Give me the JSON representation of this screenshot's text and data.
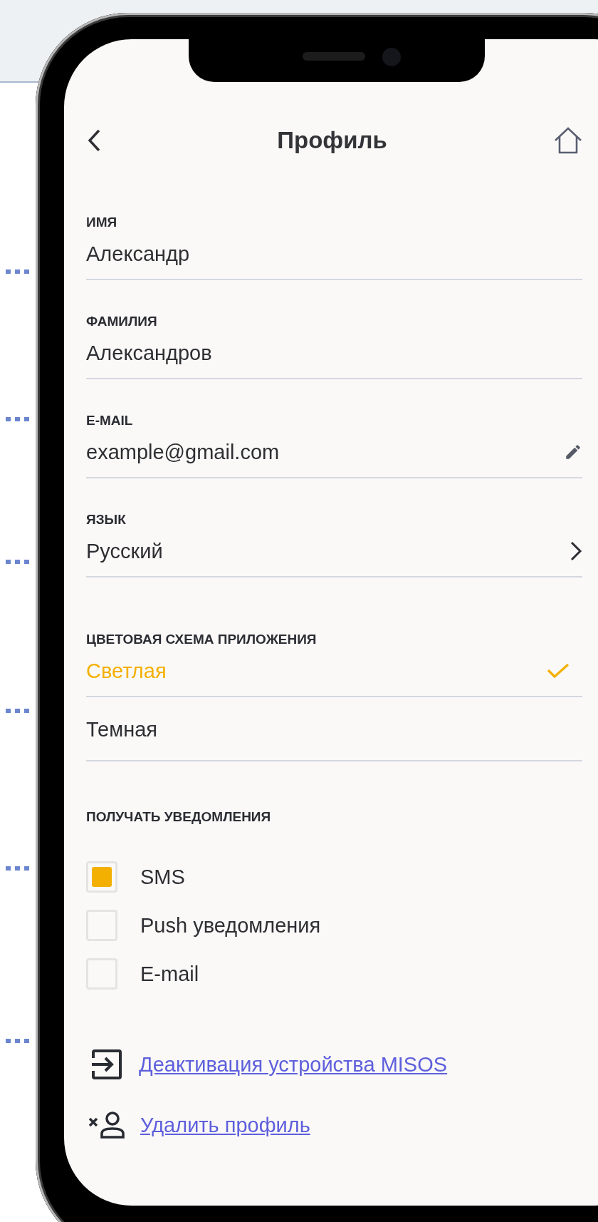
{
  "header": {
    "title": "Профиль"
  },
  "fields": [
    {
      "label": "ИМЯ",
      "value": "Александр",
      "kind": "text"
    },
    {
      "label": "ФАМИЛИЯ",
      "value": "Александров",
      "kind": "text"
    },
    {
      "label": "E-MAIL",
      "value": "example@gmail.com",
      "kind": "edit"
    },
    {
      "label": "ЯЗЫК",
      "value": "Русский",
      "kind": "select"
    }
  ],
  "color_scheme": {
    "label": "ЦВЕТОВАЯ СХЕМА ПРИЛОЖЕНИЯ",
    "options": [
      {
        "label": "Светлая",
        "selected": true
      },
      {
        "label": "Темная",
        "selected": false
      }
    ]
  },
  "notifications": {
    "label": "ПОЛУЧАТЬ УВЕДОМЛЕНИЯ",
    "options": [
      {
        "label": "SMS",
        "checked": true
      },
      {
        "label": "Push уведомления",
        "checked": false
      },
      {
        "label": "E-mail",
        "checked": false
      }
    ]
  },
  "actions": [
    {
      "label": "Деактивация устройства MISOS",
      "kind": "deactivate"
    },
    {
      "label": "Удалить профиль",
      "kind": "delete"
    }
  ]
}
